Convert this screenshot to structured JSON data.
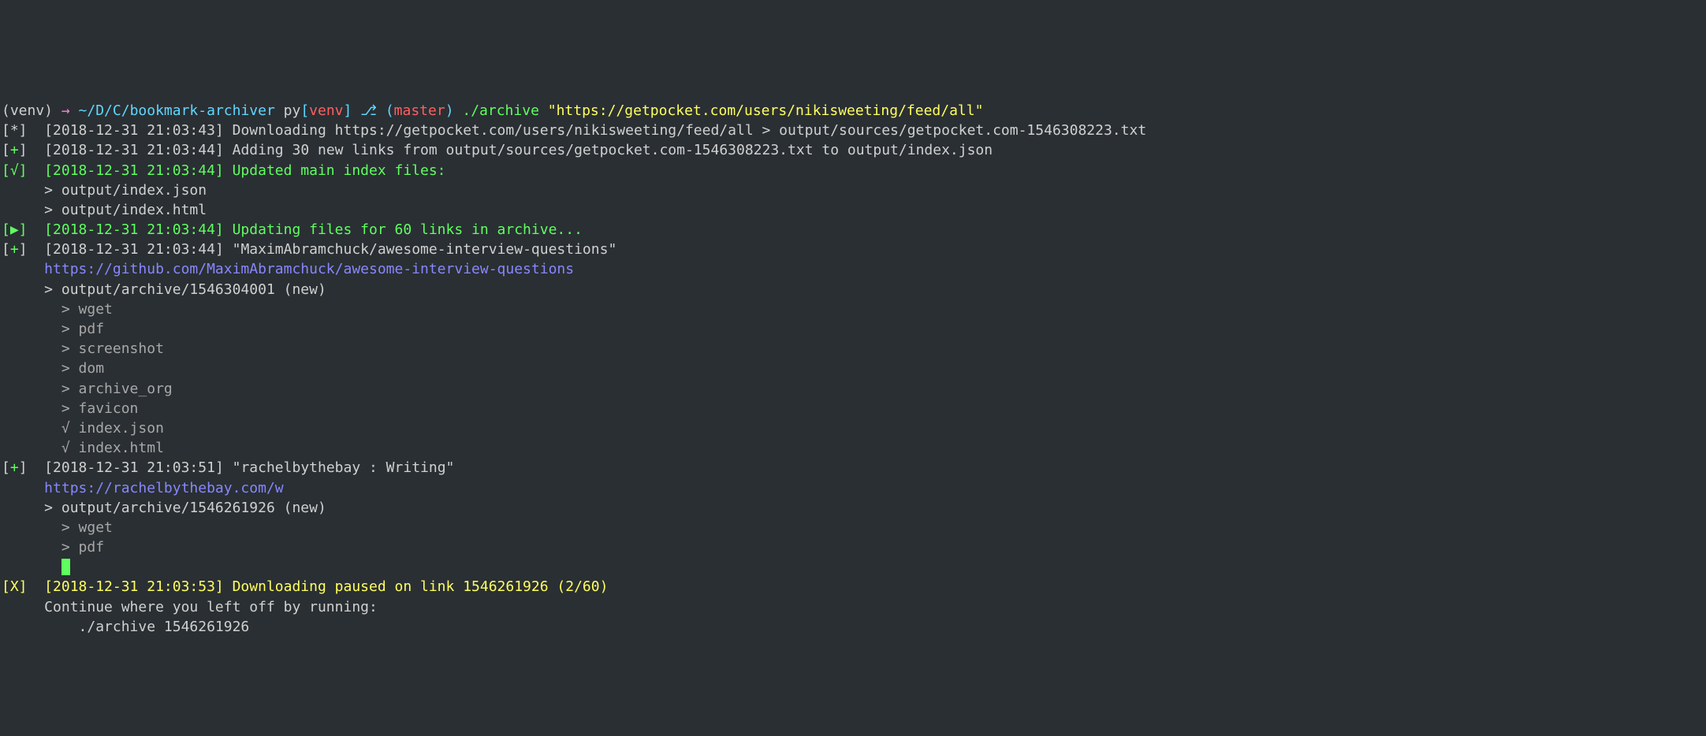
{
  "prompt": {
    "venv_open": "(venv) ",
    "arrow": "→ ",
    "cwd": "~/D/C/bookmark-archiver ",
    "py_prefix": "py",
    "py_open": "[",
    "py_env": "venv",
    "py_close": "] ",
    "branch_icon": "⎇ ",
    "branch_open": "(",
    "branch_name": "master",
    "branch_close": ") ",
    "cmd_bin": "./archive ",
    "cmd_arg": "\"https://getpocket.com/users/nikisweeting/feed/all\""
  },
  "lines": {
    "l1_tag": "[*]",
    "l1_time": "  [2018-12-31 21:03:43]",
    "l1_msg": " Downloading https://getpocket.com/users/nikisweeting/feed/all > output/sources/getpocket.com-1546308223.txt",
    "l2_open": "[",
    "l2_plus": "+",
    "l2_close": "]",
    "l2_time": "  [2018-12-31 21:03:44]",
    "l2_msg": " Adding 30 new links from output/sources/getpocket.com-1546308223.txt to output/index.json",
    "l3_tag": "[√]  [2018-12-31 21:03:44] Updated main index files:",
    "l3_a": "     > output/index.json",
    "l3_b": "     > output/index.html",
    "l4_tag": "[▶]  [2018-12-31 21:03:44] Updating files for 60 links in archive...",
    "l5_open": "[",
    "l5_plus": "+",
    "l5_close": "]",
    "l5_time": "  [2018-12-31 21:03:44]",
    "l5_msg": " \"MaximAbramchuck/awesome-interview-questions\"",
    "l5_url": "     https://github.com/MaximAbramchuck/awesome-interview-questions",
    "l5_out": "     > output/archive/1546304001 (new)",
    "l5_s1": "       > wget",
    "l5_s2": "       > pdf",
    "l5_s3": "       > screenshot",
    "l5_s4": "       > dom",
    "l5_s5": "       > archive_org",
    "l5_s6": "       > favicon",
    "l5_s7": "       √ index.json",
    "l5_s8": "       √ index.html",
    "l6_open": "[",
    "l6_plus": "+",
    "l6_close": "]",
    "l6_time": "  [2018-12-31 21:03:51]",
    "l6_msg": " \"rachelbythebay : Writing\"",
    "l6_url": "     https://rachelbythebay.com/w",
    "l6_out": "     > output/archive/1546261926 (new)",
    "l6_s1": "       > wget",
    "l6_s2": "       > pdf",
    "l6_cur_prefix": "       ",
    "l7_tag": "[X]  [2018-12-31 21:03:53] Downloading paused on link 1546261926 (2/60)",
    "l7_a": "     Continue where you left off by running:",
    "l7_b": "         ./archive 1546261926"
  }
}
